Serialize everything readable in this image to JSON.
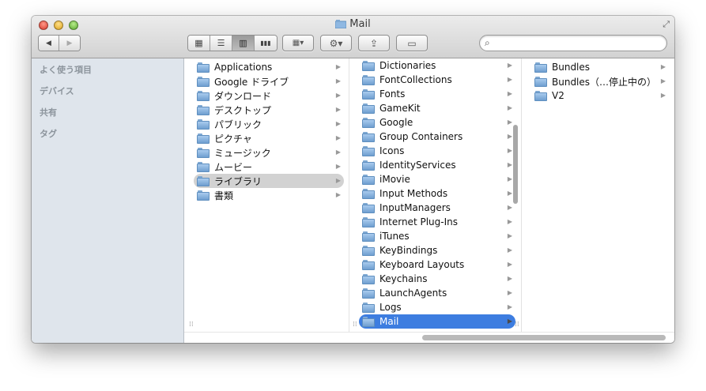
{
  "window": {
    "title": "Mail"
  },
  "toolbar": {
    "back": "◀",
    "forward": "▶",
    "view_icons": "▦",
    "view_list": "☰",
    "view_columns": "▥",
    "view_coverflow": "▮▮▮",
    "arrange": "▦▾",
    "action": "⚙▾",
    "share": "⇪",
    "tags": "▭",
    "search_placeholder": ""
  },
  "sidebar": {
    "favorites": "よく使う項目",
    "devices": "デバイス",
    "shared": "共有",
    "tags": "タグ"
  },
  "col1": [
    {
      "label": "Applications",
      "icon": "applications-folder-icon"
    },
    {
      "label": "Google ドライブ",
      "icon": "google-drive-folder-icon"
    },
    {
      "label": "ダウンロード",
      "icon": "downloads-folder-icon"
    },
    {
      "label": "デスクトップ",
      "icon": "desktop-folder-icon"
    },
    {
      "label": "パブリック",
      "icon": "public-folder-icon"
    },
    {
      "label": "ピクチャ",
      "icon": "pictures-folder-icon"
    },
    {
      "label": "ミュージック",
      "icon": "music-folder-icon"
    },
    {
      "label": "ムービー",
      "icon": "movies-folder-icon"
    },
    {
      "label": "ライブラリ",
      "icon": "library-folder-icon"
    },
    {
      "label": "書類",
      "icon": "documents-folder-icon"
    }
  ],
  "col2": [
    {
      "label": "Dictionaries"
    },
    {
      "label": "FontCollections"
    },
    {
      "label": "Fonts"
    },
    {
      "label": "GameKit"
    },
    {
      "label": "Google"
    },
    {
      "label": "Group Containers"
    },
    {
      "label": "Icons"
    },
    {
      "label": "IdentityServices"
    },
    {
      "label": "iMovie"
    },
    {
      "label": "Input Methods"
    },
    {
      "label": "InputManagers"
    },
    {
      "label": "Internet Plug-Ins"
    },
    {
      "label": "iTunes"
    },
    {
      "label": "KeyBindings"
    },
    {
      "label": "Keyboard Layouts"
    },
    {
      "label": "Keychains"
    },
    {
      "label": "LaunchAgents"
    },
    {
      "label": "Logs"
    },
    {
      "label": "Mail"
    }
  ],
  "col3": [
    {
      "label": "Bundles"
    },
    {
      "label": "Bundles（…停止中の）"
    },
    {
      "label": "V2"
    }
  ],
  "colors": {
    "selection_blue": "#3d7de0",
    "selection_grey": "#d2d2d2",
    "sidebar_bg": "#dfe5ec"
  }
}
